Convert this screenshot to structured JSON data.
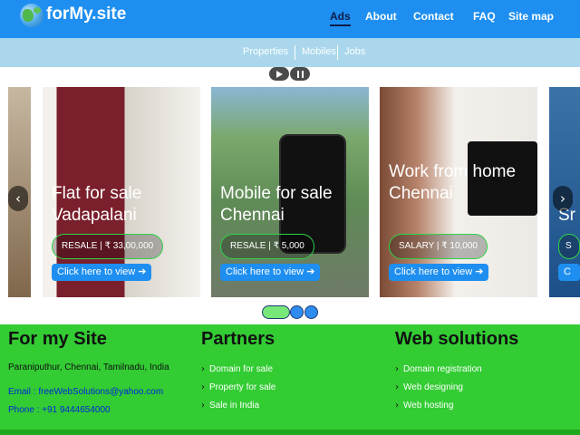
{
  "site": {
    "name": "forMy.site"
  },
  "nav": [
    "Ads",
    "About",
    "Contact",
    "FAQ",
    "Site map"
  ],
  "subnav": [
    "Properties",
    "Mobiles",
    "Jobs"
  ],
  "cards": [
    {
      "title": "Flat for sale Vadapalani",
      "badge": "RESALE | ₹ 33,00,000",
      "cta": "Click here to view ➔"
    },
    {
      "title": "Mobile for sale Chennai",
      "badge": "RESALE | ₹ 5,000",
      "cta": "Click here to view ➔"
    },
    {
      "title": "Work from home Chennai",
      "badge": "SALARY | ₹ 10,000",
      "cta": "Click here to view ➔"
    }
  ],
  "right_partial": {
    "title": "Sr",
    "badge": "S",
    "cta": "C"
  },
  "footer": {
    "about": {
      "heading": "For my Site",
      "address": "Paraniputhur, Chennai, Tamilnadu, India",
      "email": "Email : freeWebSolutions@yahoo.com",
      "phone": "Phone : +91 9444654000"
    },
    "partners": {
      "heading": "Partners",
      "links": [
        "Domain for sale",
        "Property for sale",
        "Sale in India"
      ]
    },
    "web": {
      "heading": "Web solutions",
      "links": [
        "Domain registration",
        "Web designing",
        "Web hosting"
      ]
    }
  },
  "icons": {
    "logo": "globe-icon",
    "play": "play-icon",
    "pause": "pause-icon",
    "prev": "chevron-left-icon",
    "next": "chevron-right-icon",
    "link": "chevron-right-icon"
  },
  "colors": {
    "header": "#1e8ff0",
    "subbar": "#aad7ec",
    "footer": "#33cc33",
    "badge_border": "#2fd34a",
    "cta": "#1e8ff0"
  }
}
